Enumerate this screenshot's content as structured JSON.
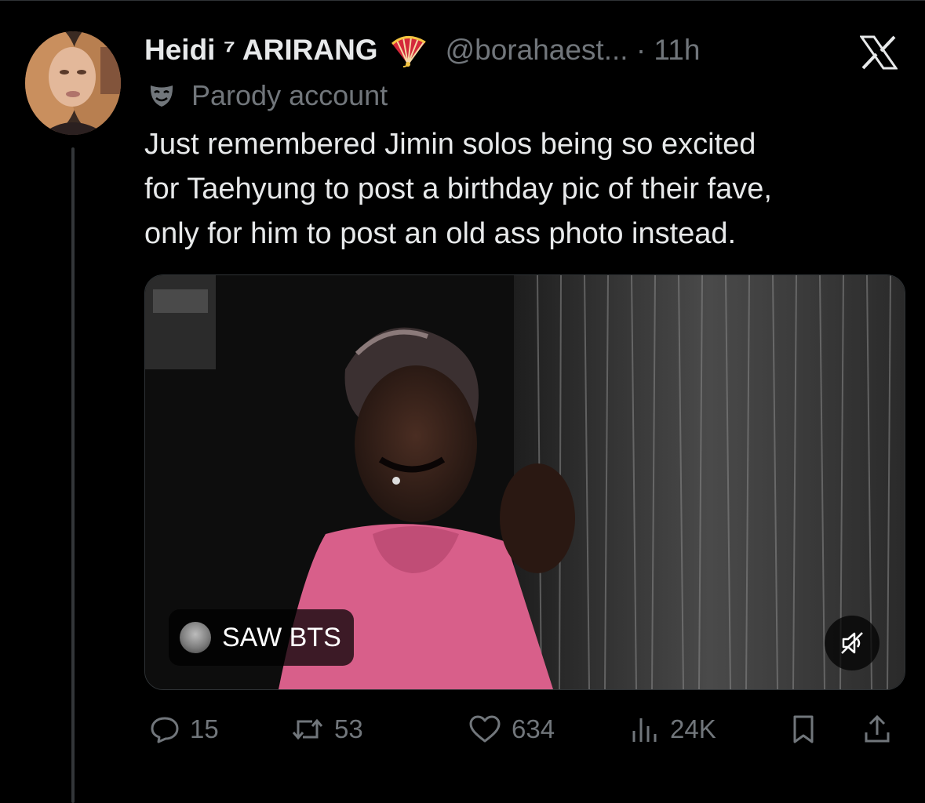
{
  "tweet": {
    "author": {
      "display_name": "Heidi ⁷ ARIRANG",
      "handle_time": "@borahaest... · 11h",
      "label": "Parody account"
    },
    "text": "Just remembered Jimin solos being so excited\nfor Taehyung to post a birthday pic of their fave,\nonly for him to post an old ass photo instead.",
    "media": {
      "source_label": "SAW BTS"
    },
    "actions": {
      "replies": "15",
      "reposts": "53",
      "likes": "634",
      "views": "24K"
    }
  },
  "colors": {
    "background": "#000000",
    "primary_text": "#e7e9ea",
    "secondary_text": "#71767b",
    "thread_line": "#333639"
  },
  "icons": [
    "x-logo-icon",
    "fan-emoji-icon",
    "parody-mask-icon",
    "reply-icon",
    "repost-icon",
    "like-icon",
    "views-icon",
    "bookmark-icon",
    "share-icon",
    "mute-icon"
  ]
}
